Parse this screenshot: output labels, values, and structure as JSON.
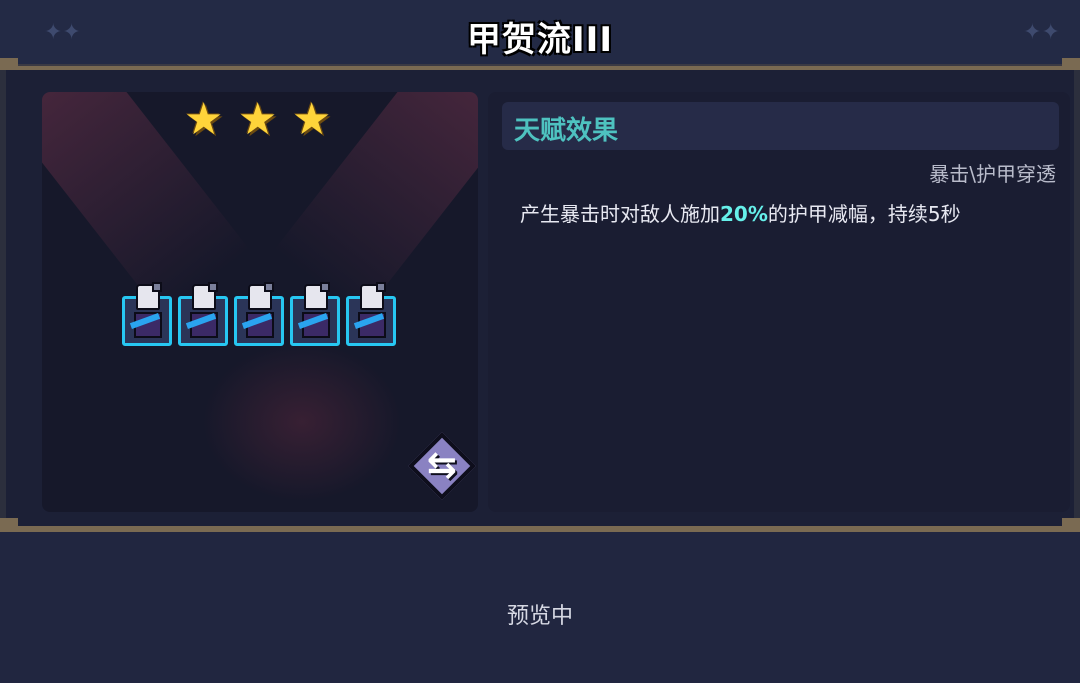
{
  "header": {
    "title": "甲贺流III"
  },
  "preview": {
    "stars": [
      "★",
      "★",
      "★"
    ],
    "unit_count": 5,
    "swap_glyph": "⇆"
  },
  "talent": {
    "section_title": "天赋效果",
    "tags": "暴击\\护甲穿透",
    "desc_before": "产生暴击时对敌人施加",
    "desc_highlight": "20%",
    "desc_after": "的护甲减幅，持续5秒"
  },
  "footer": {
    "status": "预览中"
  },
  "colors": {
    "accent_teal": "#4ec2c0",
    "highlight": "#66f0ea",
    "star": "#ffd43a",
    "unit_border": "#27c7f2"
  }
}
